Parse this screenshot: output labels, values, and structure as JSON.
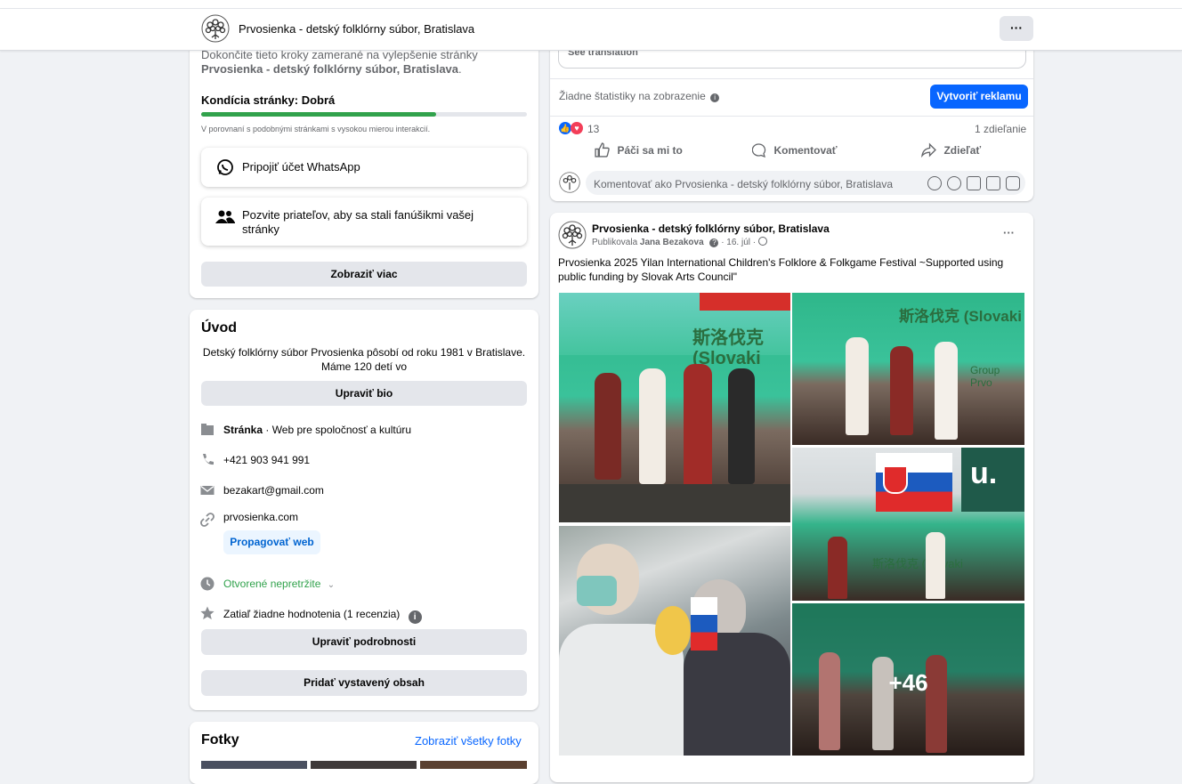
{
  "header": {
    "page_title": "Prvosienka - detský folklórny súbor, Bratislava",
    "more_label": "···"
  },
  "setup": {
    "intro_line": "Dokončite tieto kroky zamerané na vylepšenie stránky",
    "page_name": "Prvosienka - detský folklórny súbor, Bratislava",
    "condition": "Kondícia stránky: Dobrá",
    "progress": 0.72,
    "compare_note": "V porovnaní s podobnými stránkami s vysokou mierou interakcií.",
    "whatsapp": "Pripojiť účet WhatsApp",
    "invite": "Pozvite priateľov, aby sa stali fanúšikmi vašej stránky",
    "show_more": "Zobraziť viac"
  },
  "intro": {
    "heading": "Úvod",
    "bio": "Detský folklórny súbor Prvosienka pôsobí od roku 1981 v Bratislave. Máme 120 detí vo",
    "edit_bio": "Upraviť bio",
    "category_bold": "Stránka",
    "category_rest": " · Web pre spoločnosť a kultúru",
    "phone": "+421 903 941 991",
    "email": "bezakart@gmail.com",
    "website": "prvosienka.com",
    "promote": "Propagovať web",
    "hours": "Otvorené nepretržite",
    "rating": "Zatiaľ žiadne hodnotenia (1 recenzia)",
    "edit_details": "Upraviť podrobnosti",
    "add_featured": "Pridať vystavený obsah"
  },
  "photos": {
    "heading": "Fotky",
    "see_all": "Zobraziť všetky fotky"
  },
  "post1": {
    "see_translation": "See translation",
    "no_stats": "Žiadne štatistiky na zobrazenie",
    "boost": "Vytvoriť reklamu",
    "reactions": "13",
    "shares": "1 zdieľanie",
    "like": "Páči sa mi to",
    "comment": "Komentovať",
    "share": "Zdieľať",
    "comment_placeholder": "Komentovať ako Prvosienka - detský folklórny súbor, Bratislava"
  },
  "post2": {
    "author": "Prvosienka - detský folklórny súbor, Bratislava",
    "published_by_prefix": "Publikovala ",
    "published_by": "Jana Bezakova",
    "date": "· 16. júl ·",
    "text": "Prvosienka 2025 Yilan International Children's Folklore & Folkgame Festival ~Supported using public funding by Slovak Arts Council\"",
    "more_photos": "+46",
    "banner_text_1": "斯洛伐克 (Slovaki",
    "banner_text_2": "Group Prvo",
    "u_sign": "u."
  },
  "colors": {
    "accent": "#0866ff",
    "green": "#31a24c",
    "card": "#ffffff",
    "bg": "#f0f2f5"
  },
  "icons": [
    "tree-logo",
    "whatsapp-icon",
    "people-icon",
    "category-icon",
    "phone-icon",
    "mail-icon",
    "link-icon",
    "clock-icon",
    "star-icon",
    "info-icon",
    "like-icon",
    "comment-icon",
    "share-icon",
    "globe-icon"
  ]
}
